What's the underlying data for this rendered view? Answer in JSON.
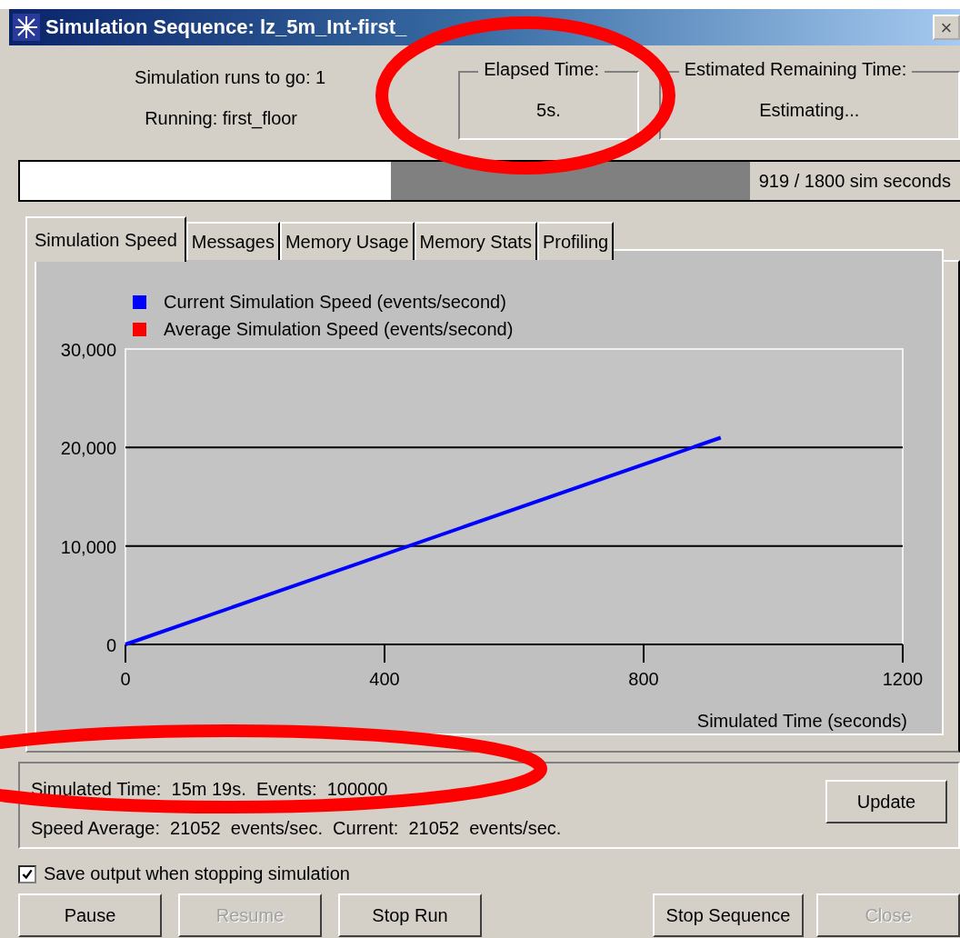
{
  "window": {
    "title": "Simulation Sequence: lz_5m_Int-first_",
    "close": "×"
  },
  "header": {
    "runs_to_go": "Simulation runs to go:  1",
    "running": "Running:  first_floor",
    "groups": [
      {
        "title": "Elapsed Time:",
        "value": "5s."
      },
      {
        "title": "Estimated Remaining Time:",
        "value": "Estimating..."
      }
    ]
  },
  "progress": {
    "level": 0.51,
    "reading": "919 / 1800 sim seconds"
  },
  "tabs": [
    {
      "label": "Simulation Speed",
      "selected": true
    },
    {
      "label": "Messages",
      "selected": false
    },
    {
      "label": "Memory Usage",
      "selected": false
    },
    {
      "label": "Memory Stats",
      "selected": false
    },
    {
      "label": "Profiling",
      "selected": false
    }
  ],
  "chart": {
    "chart_data": {
      "type": "line",
      "xlabel": "Simulated Time (seconds)",
      "x": [
        0,
        919
      ],
      "series": [
        {
          "name": "Current Simulation Speed (events/second)",
          "color": "#0000ff",
          "values": [
            0,
            21000
          ]
        },
        {
          "name": "Average Simulation Speed (events/second)",
          "color": "#ff0000",
          "values": [
            null,
            null
          ]
        }
      ],
      "legend": "top-left",
      "xlim": [
        0,
        1200
      ],
      "ylim": [
        0,
        30000
      ],
      "xticks": [
        0,
        400,
        800,
        1200
      ],
      "yticks": [
        {
          "value": 0,
          "label": "0"
        },
        {
          "value": 10000,
          "label": "10,000"
        },
        {
          "value": 20000,
          "label": "20,000"
        },
        {
          "value": 30000,
          "label": "30,000"
        }
      ]
    }
  },
  "status": {
    "lines": [
      "Simulated Time:  15m 19s.  Events:  100000",
      "Speed Average:  21052  events/sec.  Current:  21052  events/sec."
    ],
    "button": "Update"
  },
  "save_output": {
    "label": "Save output when stopping simulation",
    "checked": true
  },
  "buttons": [
    {
      "label": "Pause",
      "disabled": false
    },
    {
      "label": "Resume",
      "disabled": true
    },
    {
      "label": "Stop Run",
      "disabled": false
    },
    {
      "label": "Stop Sequence",
      "disabled": false
    },
    {
      "label": "Close",
      "disabled": true
    }
  ],
  "highlights": [
    {
      "kind": "ellipse"
    },
    {
      "kind": "ellipse"
    }
  ]
}
